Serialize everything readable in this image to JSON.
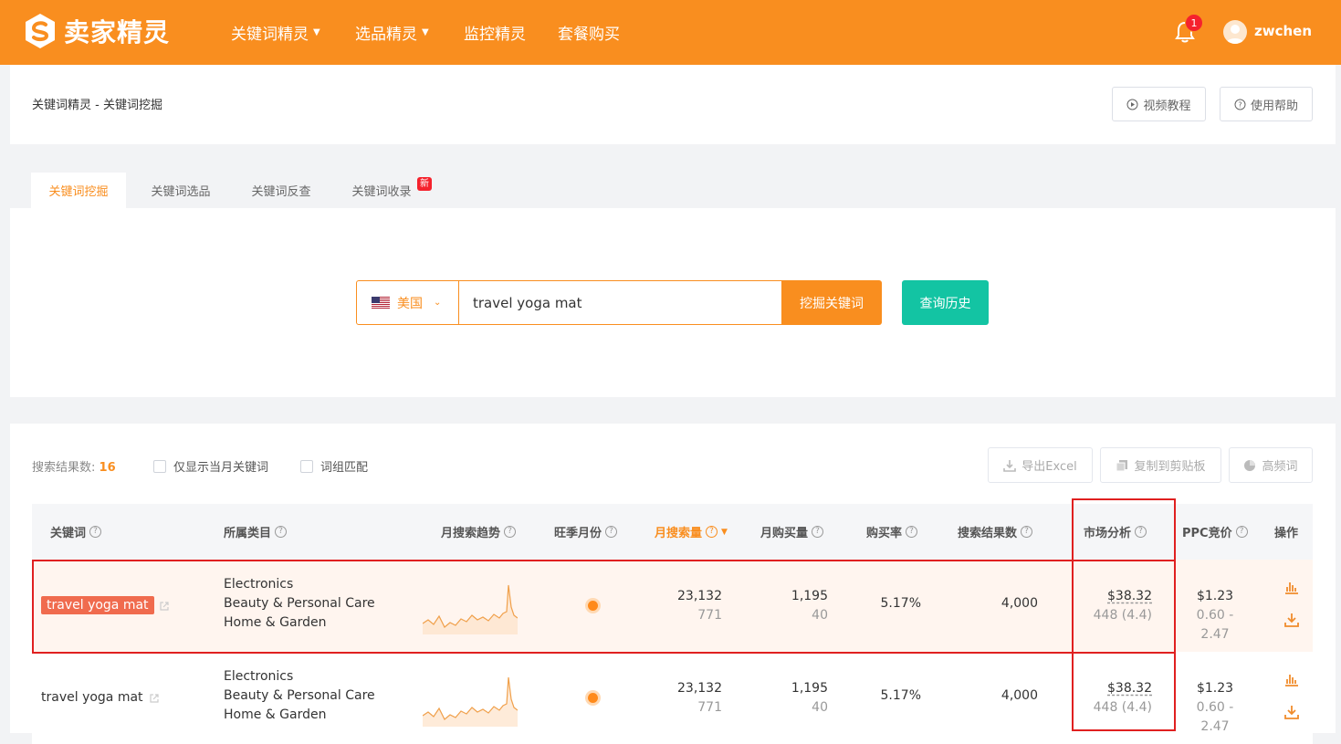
{
  "nav": {
    "logo_text": "卖家精灵",
    "items": [
      {
        "label": "关键词精灵",
        "dropdown": true
      },
      {
        "label": "选品精灵",
        "dropdown": true
      },
      {
        "label": "监控精灵",
        "dropdown": false
      },
      {
        "label": "套餐购买",
        "dropdown": false
      }
    ],
    "notification_count": "1",
    "username": "zwchen",
    "color": "#f98e1f"
  },
  "header": {
    "breadcrumb": "关键词精灵 - 关键词挖掘",
    "video_tutorial": "视频教程",
    "help": "使用帮助"
  },
  "tabs": [
    {
      "label": "关键词挖掘",
      "active": true
    },
    {
      "label": "关键词选品",
      "active": false
    },
    {
      "label": "关键词反查",
      "active": false
    },
    {
      "label": "关键词收录",
      "active": false,
      "badge": "新"
    }
  ],
  "search": {
    "country": "美国",
    "value": "travel yoga mat",
    "button": "挖掘关键词",
    "history_button": "查询历史",
    "history_color": "#13c4a3"
  },
  "results": {
    "count_label": "搜索结果数:",
    "count": "16",
    "checkbox_current_month": "仅显示当月关键词",
    "checkbox_phrase": "词组匹配",
    "export_excel": "导出Excel",
    "copy_clipboard": "复制到剪贴板",
    "high_freq": "高频词"
  },
  "table": {
    "columns": {
      "keyword": "关键词",
      "category": "所属类目",
      "trend": "月搜索趋势",
      "peak": "旺季月份",
      "monthly_search": "月搜索量",
      "monthly_purchase": "月购买量",
      "purchase_rate": "购买率",
      "search_results": "搜索结果数",
      "market": "市场分析",
      "ppc": "PPC竞价",
      "actions": "操作"
    },
    "rows": [
      {
        "keyword": "travel yoga mat",
        "highlight": true,
        "categories": [
          "Electronics",
          "Beauty & Personal Care",
          "Home & Garden"
        ],
        "monthly_search": "23,132",
        "monthly_search_sub": "771",
        "monthly_purchase": "1,195",
        "monthly_purchase_sub": "40",
        "purchase_rate": "5.17%",
        "search_results": "4,000",
        "market_price": "$38.32",
        "market_sub": "448 (4.4)",
        "ppc": "$1.23",
        "ppc_range": "0.60 - 2.47"
      },
      {
        "keyword": "travel yoga mat",
        "highlight": false,
        "categories": [
          "Electronics",
          "Beauty & Personal Care",
          "Home & Garden"
        ],
        "monthly_search": "23,132",
        "monthly_search_sub": "771",
        "monthly_purchase": "1,195",
        "monthly_purchase_sub": "40",
        "purchase_rate": "5.17%",
        "search_results": "4,000",
        "market_price": "$38.32",
        "market_sub": "448 (4.4)",
        "ppc": "$1.23",
        "ppc_range": "0.60 - 2.47"
      }
    ]
  }
}
